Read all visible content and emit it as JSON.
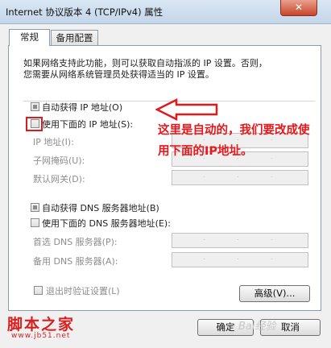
{
  "window": {
    "title": "Internet 协议版本 4 (TCP/IPv4) 属性",
    "close_glyph": "✕"
  },
  "tabs": [
    {
      "label": "常规",
      "active": true
    },
    {
      "label": "备用配置",
      "active": false
    }
  ],
  "description": [
    "如果网络支持此功能，则可以获取自动指派的 IP 设置。否则，",
    "您需要从网络系统管理员处获得适当的 IP 设置。"
  ],
  "ip_group": {
    "auto_ip_label": "自动获得 IP 地址(O)",
    "auto_ip_checked": true,
    "manual_ip_label": "使用下面的 IP 地址(S):",
    "manual_ip_checked": false,
    "fields": [
      {
        "label": "IP 地址(I):",
        "value": ""
      },
      {
        "label": "子网掩码(U):",
        "value": ""
      },
      {
        "label": "默认网关(D):",
        "value": ""
      }
    ]
  },
  "dns_group": {
    "auto_dns_label": "自动获得 DNS 服务器地址(B)",
    "auto_dns_checked": true,
    "manual_dns_label": "使用下面的 DNS 服务器地址(E):",
    "manual_dns_checked": false,
    "fields": [
      {
        "label": "首选 DNS 服务器(P):",
        "value": ""
      },
      {
        "label": "备用 DNS 服务器(A):",
        "value": ""
      }
    ]
  },
  "validate_on_exit": {
    "label": "退出时验证设置(L)",
    "checked": false
  },
  "advanced_button": "高级(V)...",
  "ok_button": "确定",
  "cancel_button": "取消",
  "annotation": {
    "line1": "这里是自动的，我们要改成使",
    "line2": "用下面的IP地址。",
    "color": "#e8171b"
  },
  "watermarks": {
    "logo": "脚本之家",
    "url": "www.jb51.net",
    "baidu": "Bai经验"
  },
  "colors": {
    "accent_red": "#e0191c",
    "panel_border": "#8d9aa8",
    "title_bar": "#c4d6ea"
  }
}
